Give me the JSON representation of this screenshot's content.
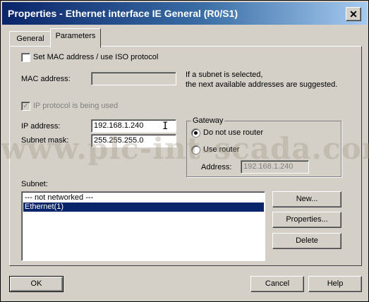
{
  "window": {
    "title": "Properties - Ethernet interface  IE General (R0/S1)",
    "close_glyph": "✕"
  },
  "tabs": [
    {
      "label": "General"
    },
    {
      "label": "Parameters"
    }
  ],
  "mac": {
    "checkbox_label": "Set MAC address / use ISO protocol",
    "address_label": "MAC address:",
    "address_value": "",
    "hint_line1": "If a subnet is selected,",
    "hint_line2": "the next available addresses are suggested."
  },
  "ip": {
    "protocol_label": "IP protocol is being used",
    "protocol_check": "✓",
    "address_label": "IP address:",
    "address_value": "192.168.1.240",
    "mask_label": "Subnet mask:",
    "mask_value": "255.255.255.0",
    "cursor": "I"
  },
  "gateway": {
    "title": "Gateway",
    "option_no_router": "Do not use router",
    "option_use_router": "Use router",
    "selected": "Do not use router",
    "address_label": "Address:",
    "address_value": "192.168.1.240"
  },
  "subnet": {
    "label": "Subnet:",
    "items": [
      {
        "label": "--- not networked ---",
        "selected": false
      },
      {
        "label": "Ethernet(1)",
        "selected": true
      }
    ],
    "buttons": {
      "new": "New...",
      "properties": "Properties...",
      "delete": "Delete"
    }
  },
  "footer": {
    "ok": "OK",
    "cancel": "Cancel",
    "help": "Help"
  },
  "watermark": "www.plc-int-scada.com"
}
